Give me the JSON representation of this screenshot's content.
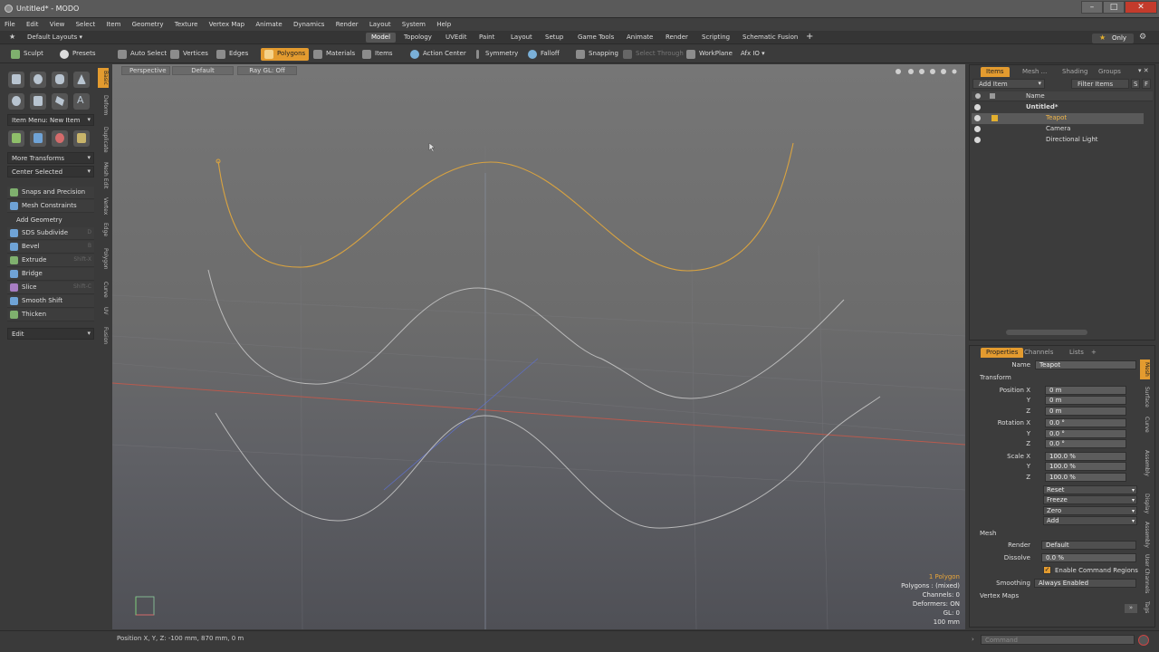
{
  "window": {
    "title": "Untitled* - MODO"
  },
  "menu": [
    "File",
    "Edit",
    "View",
    "Select",
    "Item",
    "Geometry",
    "Texture",
    "Vertex Map",
    "Animate",
    "Dynamics",
    "Render",
    "Layout",
    "System",
    "Help"
  ],
  "layout_bar": {
    "default_layouts": "Default Layouts ▾",
    "tabs": [
      "Model",
      "Topology",
      "UVEdit",
      "Paint",
      "Layout",
      "Setup",
      "Game Tools",
      "Animate",
      "Render",
      "Scripting",
      "Schematic Fusion"
    ],
    "active_tab": "Model",
    "add": "+",
    "only": "Only"
  },
  "toolbar": {
    "sculpt": "Sculpt",
    "presets": "Presets",
    "auto_select": "Auto Select",
    "vertices": "Vertices",
    "edges": "Edges",
    "polygons": "Polygons",
    "materials": "Materials",
    "items": "Items",
    "action_center": "Action Center",
    "symmetry": "Symmetry",
    "falloff": "Falloff",
    "snapping": "Snapping",
    "select_through": "Select Through",
    "workplane": "WorkPlane",
    "afx": "Afx IO ▾"
  },
  "left_panel": {
    "item_menu": "Item Menu: New Item",
    "more_transforms": "More Transforms",
    "center_selected": "Center Selected",
    "snaps": "Snaps and Precision",
    "mesh_constraints": "Mesh Constraints",
    "add_geometry": "Add Geometry",
    "tools": [
      {
        "label": "SDS Subdivide",
        "shortcut": "D"
      },
      {
        "label": "Bevel",
        "shortcut": "B"
      },
      {
        "label": "Extrude",
        "shortcut": "Shift-X"
      },
      {
        "label": "Bridge",
        "shortcut": ""
      },
      {
        "label": "Slice",
        "shortcut": "Shift-C"
      },
      {
        "label": "Smooth Shift",
        "shortcut": ""
      },
      {
        "label": "Thicken",
        "shortcut": ""
      }
    ],
    "edit": "Edit",
    "vtabs": [
      "Basic",
      "Deform",
      "Duplicate",
      "Mesh Edit",
      "Vertex",
      "Edge",
      "Polygon",
      "Curve",
      "UV",
      "Fusion"
    ]
  },
  "viewport": {
    "view": "Perspective",
    "style": "Default",
    "raygl": "Ray GL: Off",
    "stats": {
      "polygons_selected": "1 Polygon",
      "polygons": "Polygons : (mixed)",
      "channels": "Channels: 0",
      "deformers": "Deformers: ON",
      "gl": "GL: 0",
      "grid": "100 mm"
    }
  },
  "items_panel": {
    "tabs": [
      "Items",
      "Mesh ...",
      "Shading",
      "Groups"
    ],
    "add_item": "Add Item",
    "filter_items": "Filter Items",
    "col_name": "Name",
    "tree": [
      {
        "label": "Untitled*",
        "indent": 1,
        "selected": false,
        "bold": true
      },
      {
        "label": "Teapot",
        "indent": 2,
        "selected": true,
        "bold": false
      },
      {
        "label": "Camera",
        "indent": 2,
        "selected": false,
        "bold": false
      },
      {
        "label": "Directional Light",
        "indent": 2,
        "selected": false,
        "bold": false
      }
    ]
  },
  "properties_panel": {
    "tabs": [
      "Properties",
      "Channels",
      "Lists",
      "+"
    ],
    "name_label": "Name",
    "name_value": "Teapot",
    "transform": "Transform",
    "position_label": "Position X",
    "rotation_label": "Rotation X",
    "scale_label": "Scale X",
    "axis_y": "Y",
    "axis_z": "Z",
    "position": [
      "0 m",
      "0 m",
      "0 m"
    ],
    "rotation": [
      "0.0 °",
      "0.0 °",
      "0.0 °"
    ],
    "scale": [
      "100.0 %",
      "100.0 %",
      "100.0 %"
    ],
    "actions": [
      "Reset",
      "Freeze",
      "Zero",
      "Add"
    ],
    "mesh": "Mesh",
    "render_label": "Render",
    "render_value": "Default",
    "dissolve_label": "Dissolve",
    "dissolve_value": "0.0 %",
    "enable_command_regions": "Enable Command Regions",
    "smoothing_label": "Smoothing",
    "smoothing_value": "Always Enabled",
    "vertex_maps": "Vertex Maps",
    "vtabs": [
      "Mesh",
      "Surface",
      "Curve",
      "Assembly",
      "Display",
      "Assembly",
      "User Channels",
      "Tags"
    ]
  },
  "statusbar": {
    "position": "Position X, Y, Z:  -100 mm, 870 mm, 0 m",
    "command_placeholder": "Command"
  },
  "colors": {
    "accent": "#e39b2f",
    "selected_curve": "#d9a340",
    "curve": "#c9c9c9",
    "x_axis": "#b85a4e",
    "z_axis": "#5e6fc6"
  }
}
